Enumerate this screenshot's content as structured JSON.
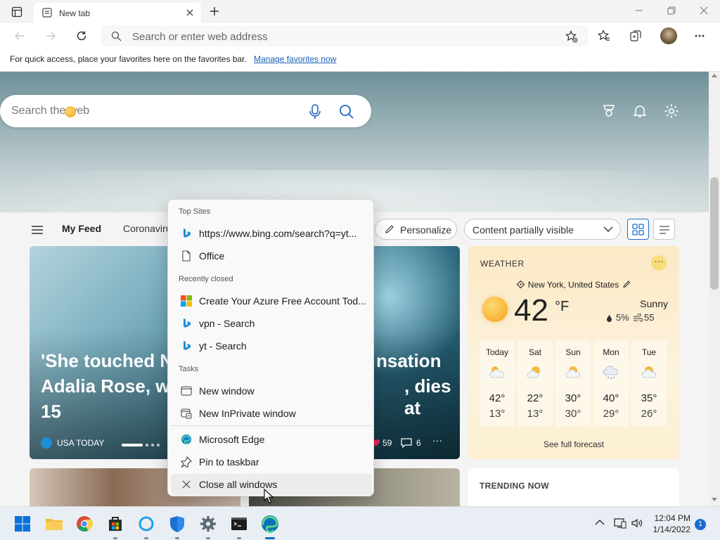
{
  "browser": {
    "tab": {
      "title": "New tab"
    },
    "address_bar": {
      "placeholder": "Search or enter web address"
    },
    "favorites_bar": {
      "message": "For quick access, place your favorites here on the favorites bar.",
      "link": "Manage favorites now"
    }
  },
  "newtab": {
    "search": {
      "placeholder": "Search the web"
    },
    "feed_nav": {
      "my_feed": "My Feed",
      "coronavirus": "Coronaviru",
      "personalize": "Personalize",
      "content_visibility": "Content partially visible"
    },
    "hero_card": {
      "headline_lines": [
        "'She touched N",
        "Adalia Rose, w",
        "15"
      ],
      "headline_right_lines": [
        "nsation",
        ", dies at"
      ],
      "source": "USA TODAY",
      "likes": "59",
      "comments": "6"
    },
    "weather": {
      "title": "WEATHER",
      "location": "New York, United States",
      "temperature": "42",
      "unit": "°F",
      "condition": "Sunny",
      "precipitation": "5%",
      "wind": "55",
      "forecast": [
        {
          "day": "Today",
          "high": "42°",
          "low": "13°",
          "icon": "partly-cloudy-icon"
        },
        {
          "day": "Sat",
          "high": "22°",
          "low": "13°",
          "icon": "partly-sunny-icon"
        },
        {
          "day": "Sun",
          "high": "30°",
          "low": "30°",
          "icon": "partly-sunny-icon"
        },
        {
          "day": "Mon",
          "high": "40°",
          "low": "29°",
          "icon": "snow-cloud-icon"
        },
        {
          "day": "Tue",
          "high": "35°",
          "low": "26°",
          "icon": "partly-sunny-icon"
        }
      ],
      "full_forecast_link": "See full forecast"
    },
    "trending": {
      "title": "TRENDING NOW"
    }
  },
  "jump_list": {
    "top_sites_header": "Top Sites",
    "top_sites": [
      "https://www.bing.com/search?q=yt...",
      "Office"
    ],
    "recently_closed_header": "Recently closed",
    "recently_closed": [
      "Create Your Azure Free Account Tod...",
      "vpn - Search",
      "yt - Search"
    ],
    "tasks_header": "Tasks",
    "tasks": [
      "New window",
      "New InPrivate window"
    ],
    "app_actions": [
      "Microsoft Edge",
      "Pin to taskbar",
      "Close all windows"
    ]
  },
  "taskbar": {
    "apps": [
      "start",
      "file-explorer",
      "chrome",
      "microsoft-store",
      "cortana",
      "windows-security",
      "settings",
      "terminal",
      "edge"
    ],
    "clock_time": "12:04 PM",
    "clock_date": "1/14/2022",
    "notification_count": "1"
  },
  "colors": {
    "accent": "#0f6cbd",
    "weather_bg": "#fdf2dc",
    "hero_sky": "#90aab0"
  }
}
